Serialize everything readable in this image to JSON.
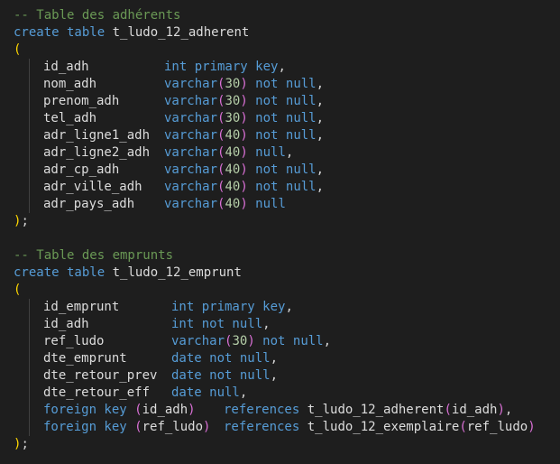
{
  "colors": {
    "background": "#1e1e1e",
    "comment": "#6a9955",
    "keyword": "#569cd6",
    "identifier": "#dcdcdc",
    "bracket_outer": "#ffd700",
    "bracket_inner": "#da70d6",
    "number": "#b5cea8"
  },
  "block1": {
    "comment": "-- Table des adhérents",
    "create": "create table",
    "table": "t_ludo_12_adherent",
    "open": "(",
    "close": ");",
    "cols": [
      {
        "name": "id_adh",
        "type": "int primary key",
        "len": "",
        "rest": ","
      },
      {
        "name": "nom_adh",
        "type": "varchar",
        "len": "30",
        "rest": " not null,"
      },
      {
        "name": "prenom_adh",
        "type": "varchar",
        "len": "30",
        "rest": " not null,"
      },
      {
        "name": "tel_adh",
        "type": "varchar",
        "len": "30",
        "rest": " not null,"
      },
      {
        "name": "adr_ligne1_adh",
        "type": "varchar",
        "len": "40",
        "rest": " not null,"
      },
      {
        "name": "adr_ligne2_adh",
        "type": "varchar",
        "len": "40",
        "rest": " null,"
      },
      {
        "name": "adr_cp_adh",
        "type": "varchar",
        "len": "40",
        "rest": " not null,"
      },
      {
        "name": "adr_ville_adh",
        "type": "varchar",
        "len": "40",
        "rest": " not null,"
      },
      {
        "name": "adr_pays_adh",
        "type": "varchar",
        "len": "40",
        "rest": " null"
      }
    ]
  },
  "block2": {
    "comment": "-- Table des emprunts",
    "create": "create table",
    "table": "t_ludo_12_emprunt",
    "open": "(",
    "close": ");",
    "cols": [
      {
        "name": "id_emprunt",
        "type": "int primary key",
        "len": "",
        "rest": ","
      },
      {
        "name": "id_adh",
        "type": "int not null",
        "len": "",
        "rest": ","
      },
      {
        "name": "ref_ludo",
        "type": "varchar",
        "len": "30",
        "rest": " not null,"
      },
      {
        "name": "dte_emprunt",
        "type": "date not null",
        "len": "",
        "rest": ","
      },
      {
        "name": "dte_retour_prev",
        "type": "date not null",
        "len": "",
        "rest": ","
      },
      {
        "name": "dte_retour_eff",
        "type": "date null",
        "len": "",
        "rest": ","
      }
    ],
    "fks": [
      {
        "kw": "foreign key",
        "col": "id_adh",
        "refkw": "references",
        "reftable": "t_ludo_12_adherent",
        "refcol": "id_adh",
        "end": ","
      },
      {
        "kw": "foreign key",
        "col": "ref_ludo",
        "refkw": "references",
        "reftable": "t_ludo_12_exemplaire",
        "refcol": "ref_ludo",
        "end": ""
      }
    ]
  }
}
